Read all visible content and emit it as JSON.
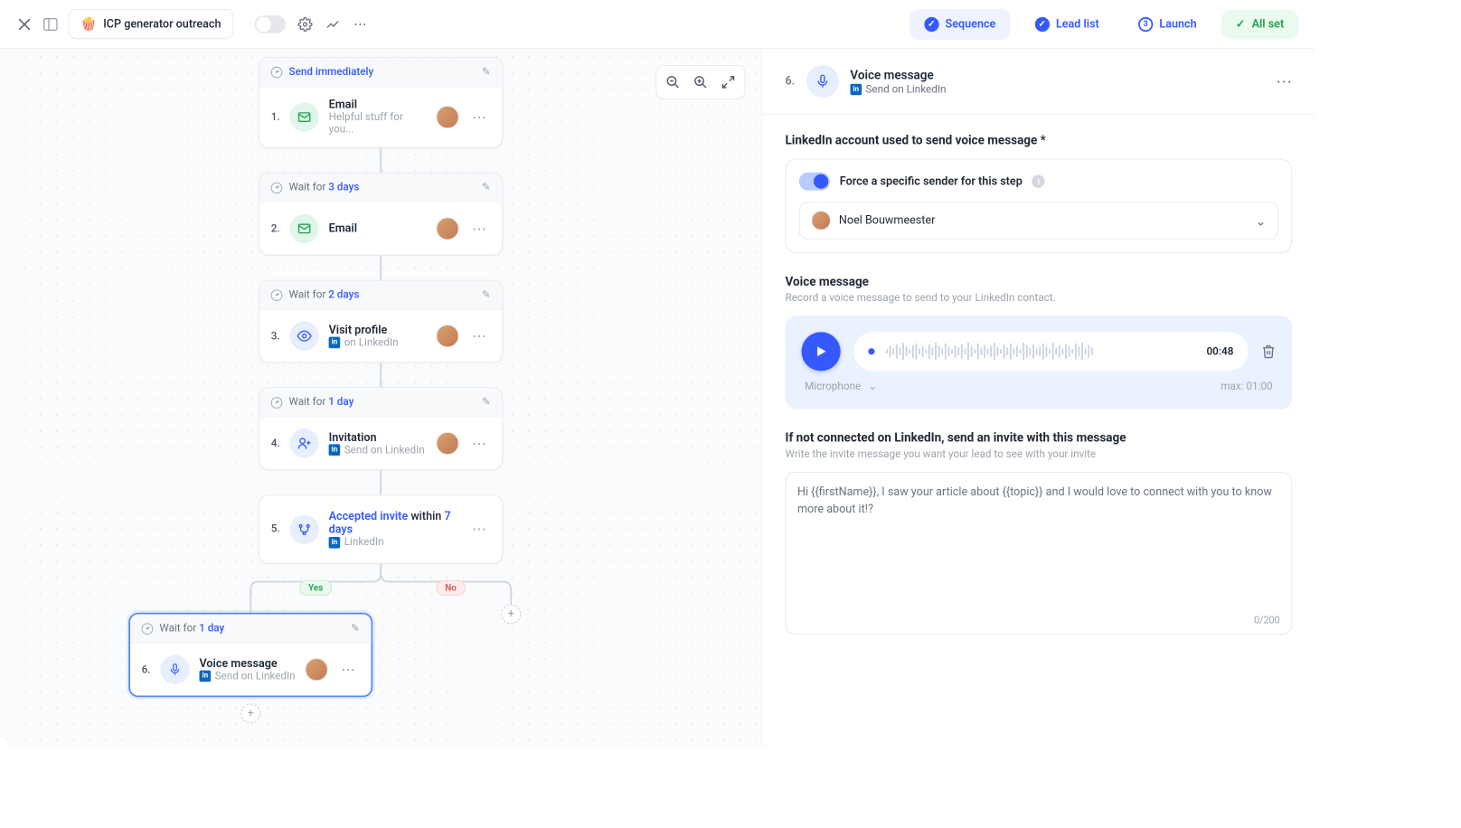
{
  "topbar": {
    "project_emoji": "🍿",
    "project_name": "ICP generator outreach",
    "tabs": {
      "sequence": "Sequence",
      "leadlist": "Lead list",
      "launch": "Launch",
      "launch_num": "3",
      "allset": "All set"
    }
  },
  "flow": {
    "step1": {
      "wait_prefix": "",
      "wait_link": "Send immediately",
      "num": "1.",
      "title": "Email",
      "sub": "Helpful stuff for you..."
    },
    "step2": {
      "wait_prefix": "Wait for ",
      "wait_link": "3 days",
      "num": "2.",
      "title": "Email"
    },
    "step3": {
      "wait_prefix": "Wait for ",
      "wait_link": "2 days",
      "num": "3.",
      "title": "Visit profile",
      "sub": "on LinkedIn"
    },
    "step4": {
      "wait_prefix": "Wait for ",
      "wait_link": "1 day",
      "num": "4.",
      "title": "Invitation",
      "sub": "Send on LinkedIn"
    },
    "step5": {
      "num": "5.",
      "title_link": "Accepted invite",
      "title_mid": " within ",
      "title_link2": "7 days",
      "sub": "LinkedIn"
    },
    "branch": {
      "yes": "Yes",
      "no": "No"
    },
    "step6": {
      "wait_prefix": "Wait for ",
      "wait_link": "1 day",
      "num": "6.",
      "title": "Voice message",
      "sub": "Send on LinkedIn"
    }
  },
  "panel": {
    "step_num": "6.",
    "title": "Voice message",
    "subtitle": "Send on LinkedIn",
    "account_h": "LinkedIn account used to send voice message *",
    "force_label": "Force a specific sender for this step",
    "sender_name": "Noel Bouwmeester",
    "voice_h": "Voice message",
    "voice_sub": "Record a voice message to send to your LinkedIn contact.",
    "duration": "00:48",
    "mic_label": "Microphone",
    "max_label": "max: 01:00",
    "invite_h": "If not connected on LinkedIn, send an invite with this message",
    "invite_sub": "Write the invite message you want your lead to see with your invite",
    "invite_text": "Hi {{firstName}}, I saw your article about {{topic}} and I would love to connect with you to know more about it!?",
    "counter": "0/200"
  }
}
